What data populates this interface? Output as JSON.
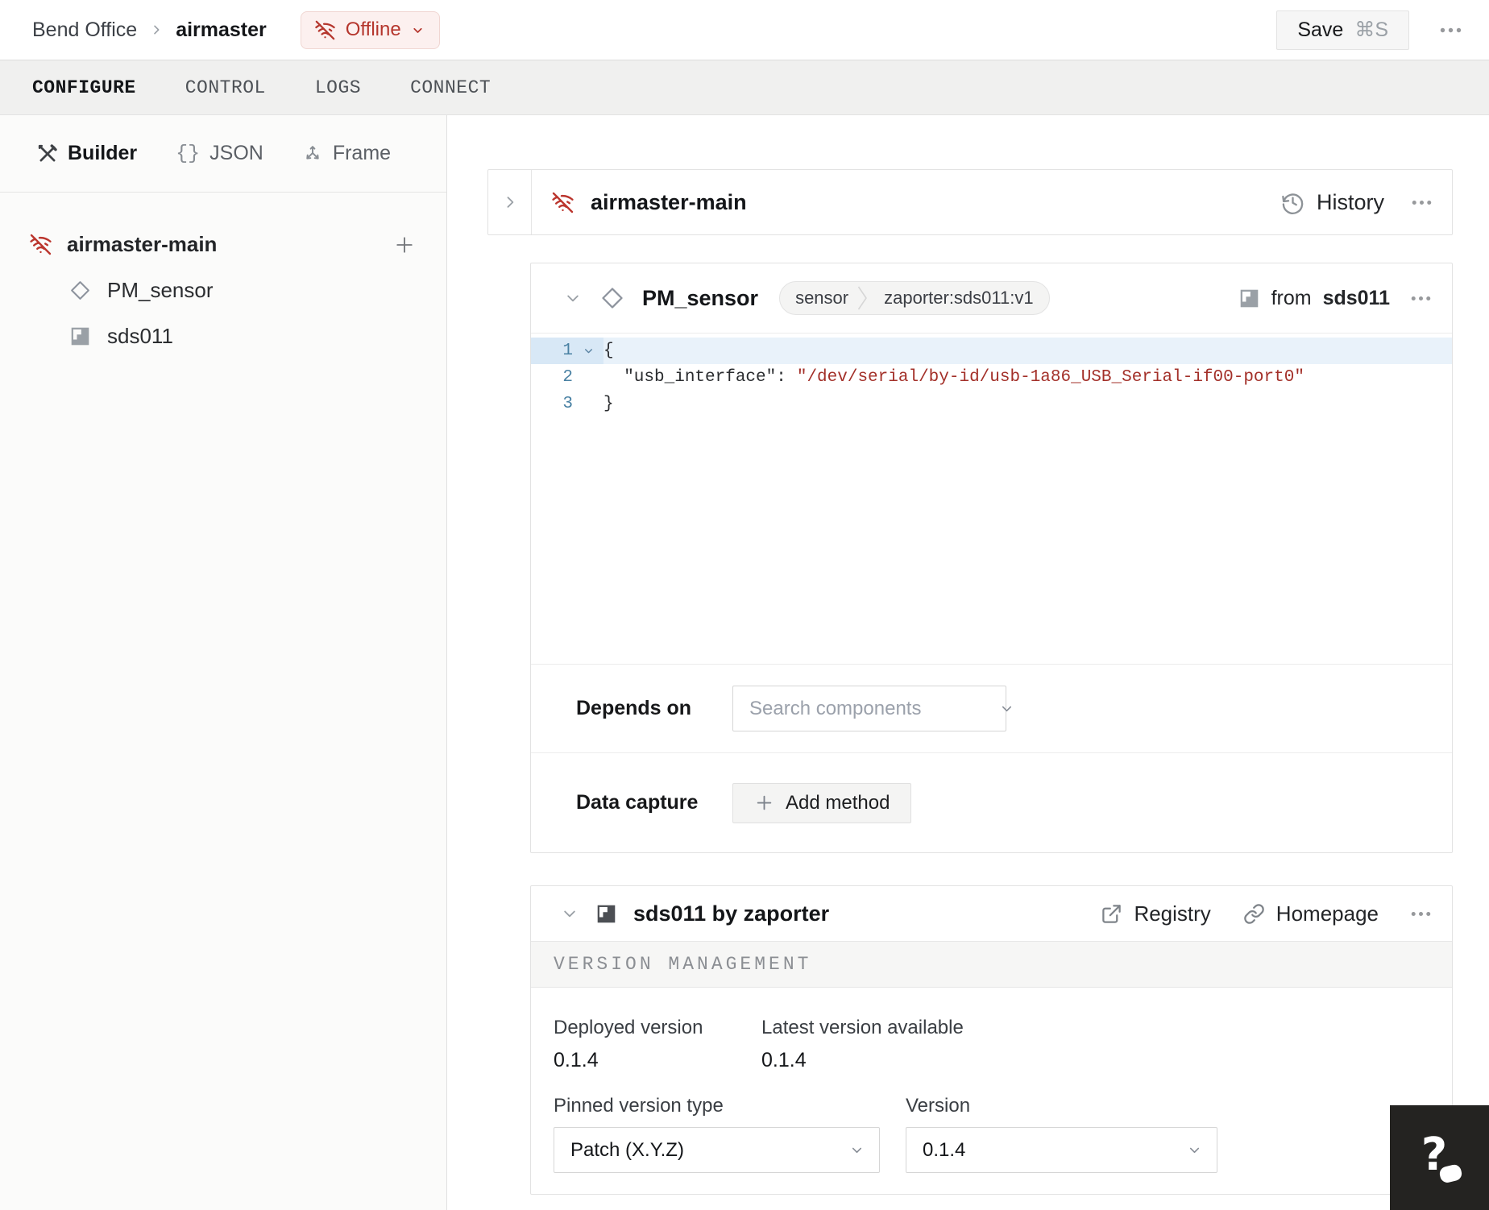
{
  "topbar": {
    "org": "Bend Office",
    "machine": "airmaster",
    "status_label": "Offline",
    "save_label": "Save",
    "save_shortcut": "⌘S"
  },
  "tabs": [
    {
      "label": "CONFIGURE",
      "active": true
    },
    {
      "label": "CONTROL",
      "active": false
    },
    {
      "label": "LOGS",
      "active": false
    },
    {
      "label": "CONNECT",
      "active": false
    }
  ],
  "sidebar": {
    "modes": [
      {
        "label": "Builder",
        "active": true
      },
      {
        "label": "JSON",
        "active": false,
        "icon_glyph": "{}"
      },
      {
        "label": "Frame",
        "active": false
      }
    ],
    "tree": [
      {
        "label": "airmaster-main"
      },
      {
        "label": "PM_sensor"
      },
      {
        "label": "sds011"
      }
    ],
    "add_label": "+"
  },
  "machine_card": {
    "title": "airmaster-main",
    "history_label": "History"
  },
  "component_card": {
    "title": "PM_sensor",
    "tag_type": "sensor",
    "tag_model": "zaporter:sds011:v1",
    "from_prefix": "from",
    "from_module": "sds011",
    "editor": {
      "n1": "1",
      "n2": "2",
      "n3": "3",
      "line1": "{",
      "line2_key": "  \"usb_interface\":",
      "line2_value": "\"/dev/serial/by-id/usb-1a86_USB_Serial-if00-port0\"",
      "line3": "}"
    },
    "depends_label": "Depends on",
    "depends_placeholder": "Search components",
    "capture_label": "Data capture",
    "add_method_label": "Add method"
  },
  "module_card": {
    "title": "sds011 by zaporter",
    "registry_label": "Registry",
    "homepage_label": "Homepage",
    "section_title": "VERSION MANAGEMENT",
    "deployed_label": "Deployed version",
    "deployed_value": "0.1.4",
    "latest_label": "Latest version available",
    "latest_value": "0.1.4",
    "pinned_label": "Pinned version type",
    "pinned_value": "Patch (X.Y.Z)",
    "version_label": "Version",
    "version_value": "0.1.4"
  },
  "colors": {
    "offline_red": "#b5362d",
    "offline_bg": "#fcf0ef",
    "code_string": "#a33029",
    "line_number": "#4981a3",
    "active_line_bg": "#e9f2fa"
  }
}
